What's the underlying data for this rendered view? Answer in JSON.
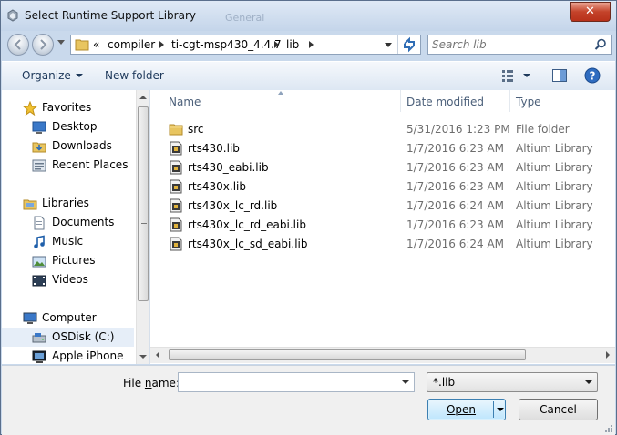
{
  "window": {
    "title": "Select Runtime Support Library",
    "ghost_title": "General",
    "close_glyph": "✕"
  },
  "address": {
    "overflow": "«",
    "crumbs": [
      "compiler",
      "ti-cgt-msp430_4.4.7",
      "lib"
    ]
  },
  "search": {
    "placeholder": "Search lib"
  },
  "toolbar": {
    "organize": "Organize",
    "new_folder": "New folder"
  },
  "sidebar": {
    "items": [
      {
        "label": "Favorites",
        "icon": "star-icon"
      },
      {
        "label": "Desktop",
        "icon": "desktop-icon"
      },
      {
        "label": "Downloads",
        "icon": "downloads-icon"
      },
      {
        "label": "Recent Places",
        "icon": "recent-places-icon"
      },
      {
        "label": "Libraries",
        "icon": "libraries-icon"
      },
      {
        "label": "Documents",
        "icon": "documents-icon"
      },
      {
        "label": "Music",
        "icon": "music-icon"
      },
      {
        "label": "Pictures",
        "icon": "pictures-icon"
      },
      {
        "label": "Videos",
        "icon": "videos-icon"
      },
      {
        "label": "Computer",
        "icon": "computer-icon"
      },
      {
        "label": "OSDisk (C:)",
        "icon": "drive-icon"
      },
      {
        "label": "Apple iPhone",
        "icon": "phone-icon"
      }
    ],
    "selected": "OSDisk (C:)"
  },
  "columns": {
    "name": "Name",
    "date": "Date modified",
    "type": "Type"
  },
  "files": [
    {
      "name": "src",
      "date": "5/31/2016 1:23 PM",
      "type": "File folder",
      "icon": "folder-icon"
    },
    {
      "name": "rts430.lib",
      "date": "1/7/2016 6:23 AM",
      "type": "Altium Library",
      "icon": "library-file-icon"
    },
    {
      "name": "rts430_eabi.lib",
      "date": "1/7/2016 6:23 AM",
      "type": "Altium Library",
      "icon": "library-file-icon"
    },
    {
      "name": "rts430x.lib",
      "date": "1/7/2016 6:23 AM",
      "type": "Altium Library",
      "icon": "library-file-icon"
    },
    {
      "name": "rts430x_lc_rd.lib",
      "date": "1/7/2016 6:24 AM",
      "type": "Altium Library",
      "icon": "library-file-icon"
    },
    {
      "name": "rts430x_lc_rd_eabi.lib",
      "date": "1/7/2016 6:23 AM",
      "type": "Altium Library",
      "icon": "library-file-icon"
    },
    {
      "name": "rts430x_lc_sd_eabi.lib",
      "date": "1/7/2016 6:24 AM",
      "type": "Altium Library",
      "icon": "library-file-icon"
    }
  ],
  "footer": {
    "filename_label_pre": "File ",
    "filename_label_key": "n",
    "filename_label_post": "ame:",
    "filename_value": "",
    "filetype": "*.lib",
    "open": "Open",
    "cancel": "Cancel"
  },
  "colors": {
    "frame": "#c9d9ec",
    "accent": "#3c7fb1",
    "close": "#c4432a"
  }
}
